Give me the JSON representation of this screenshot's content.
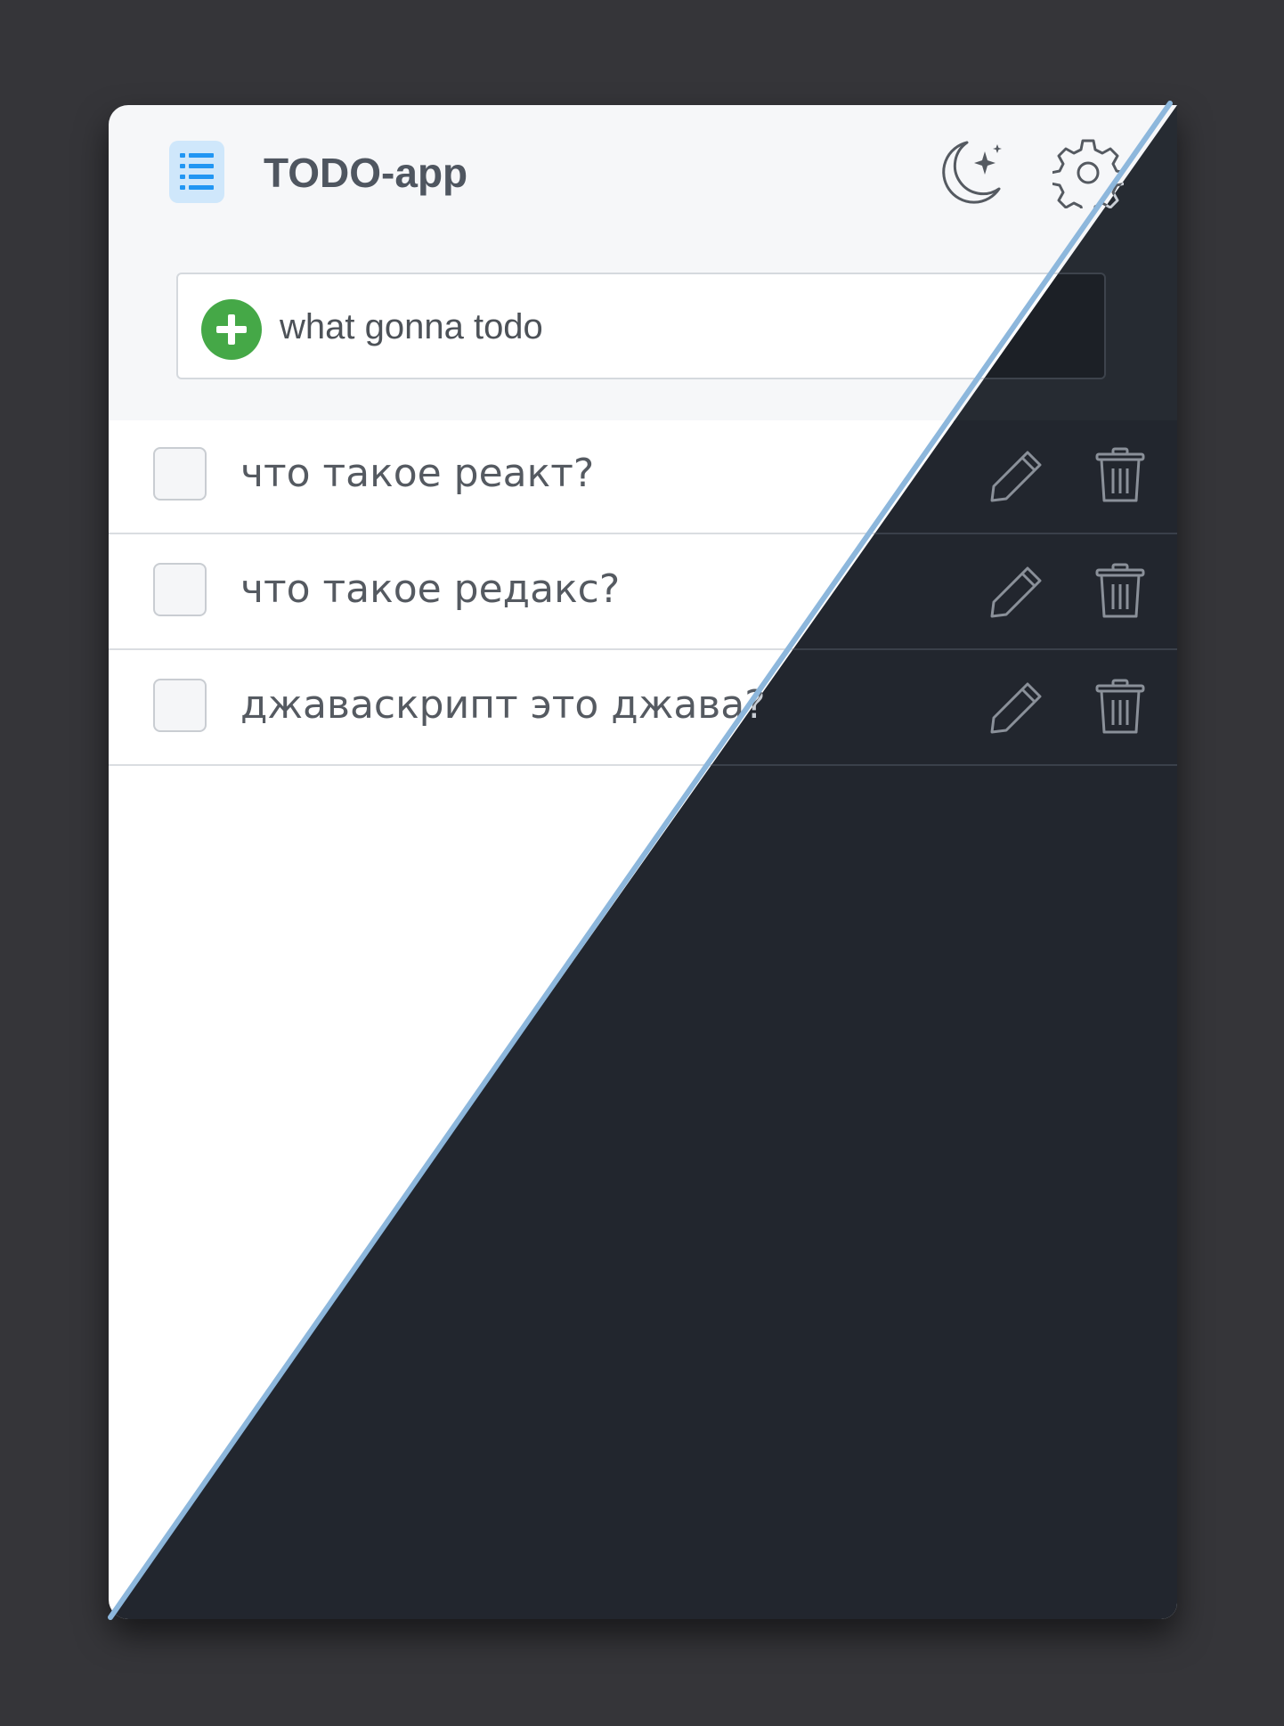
{
  "app": {
    "title": "TODO-app"
  },
  "header": {
    "app_icon": "list-icon",
    "theme_toggle_icon": "moon-stars-icon",
    "settings_icon": "gear-icon"
  },
  "add_todo": {
    "icon": "plus-circle-icon",
    "placeholder": "what gonna todo",
    "value": ""
  },
  "todos": [
    {
      "text": "что такое реакт?",
      "done": false
    },
    {
      "text": "что такое редакс?",
      "done": false
    },
    {
      "text": "джаваскрипт это джава?",
      "done": false
    }
  ],
  "colors": {
    "background": "#353539",
    "light_surface": "#ffffff",
    "light_header": "#f6f7f9",
    "dark_surface": "#22262e",
    "dark_header": "#262b32",
    "accent_blue": "#2196f3",
    "add_green": "#45a847",
    "divider": "#8db7dc"
  }
}
